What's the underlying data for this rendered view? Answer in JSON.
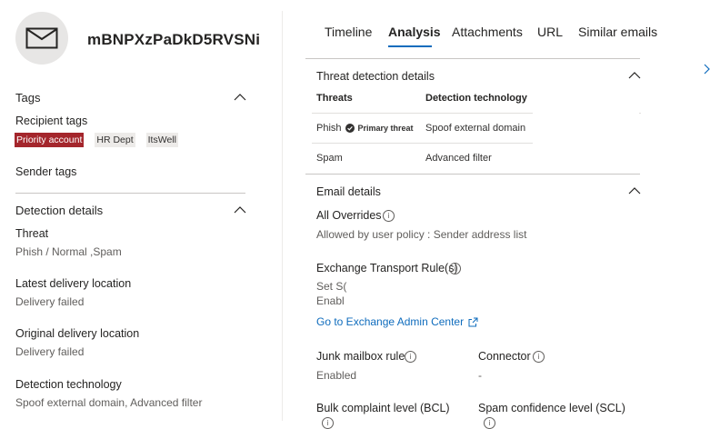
{
  "email": {
    "subject": "mBNPXzPaDkD5RVSNi"
  },
  "tags": {
    "title": "Tags",
    "recipient_tags_label": "Recipient tags",
    "recipient_tags": [
      "Priority account",
      "HR Dept",
      "ItsWell"
    ],
    "sender_tags_label": "Sender tags"
  },
  "detection": {
    "title": "Detection details",
    "threat_label": "Threat",
    "threat_value": "Phish / Normal ,Spam",
    "latest_label": "Latest delivery location",
    "latest_value": "Delivery failed",
    "original_label": "Original delivery location",
    "original_value": "Delivery failed",
    "tech_label": "Detection technology",
    "tech_value": "Spoof external domain, Advanced filter"
  },
  "tabs": [
    "Timeline",
    "Analysis",
    "Attachments",
    "URL",
    "Similar emails"
  ],
  "threat_detection": {
    "title": "Threat detection details",
    "col_threats": "Threats",
    "col_tech": "Detection technology",
    "rows": [
      {
        "threat": "Phish",
        "badge": "Primary threat",
        "tech": "Spoof external domain"
      },
      {
        "threat": "Spam",
        "badge": "",
        "tech": "Advanced filter"
      }
    ]
  },
  "email_details": {
    "title": "Email details",
    "overrides_label": "All Overrides",
    "overrides_value": "Allowed by user policy : Sender address list",
    "etr_label": "Exchange Transport Rule(s)",
    "etr_line1": "Set S(",
    "etr_line2": "Enabl",
    "exchange_link": "Go to Exchange Admin Center",
    "junk_label": "Junk mailbox rule",
    "junk_value": "Enabled",
    "connector_label": "Connector",
    "connector_value": "-",
    "bcl_label": "Bulk complaint level (BCL)",
    "scl_label": "Spam confidence level (SCL)"
  },
  "colors": {
    "accent": "#0f6cbd",
    "priority_tag": "#a4262c"
  },
  "icons": [
    "mail-icon",
    "chevron-up-icon",
    "info-icon",
    "check-circle-icon",
    "external-link-icon",
    "chevron-right-icon"
  ]
}
